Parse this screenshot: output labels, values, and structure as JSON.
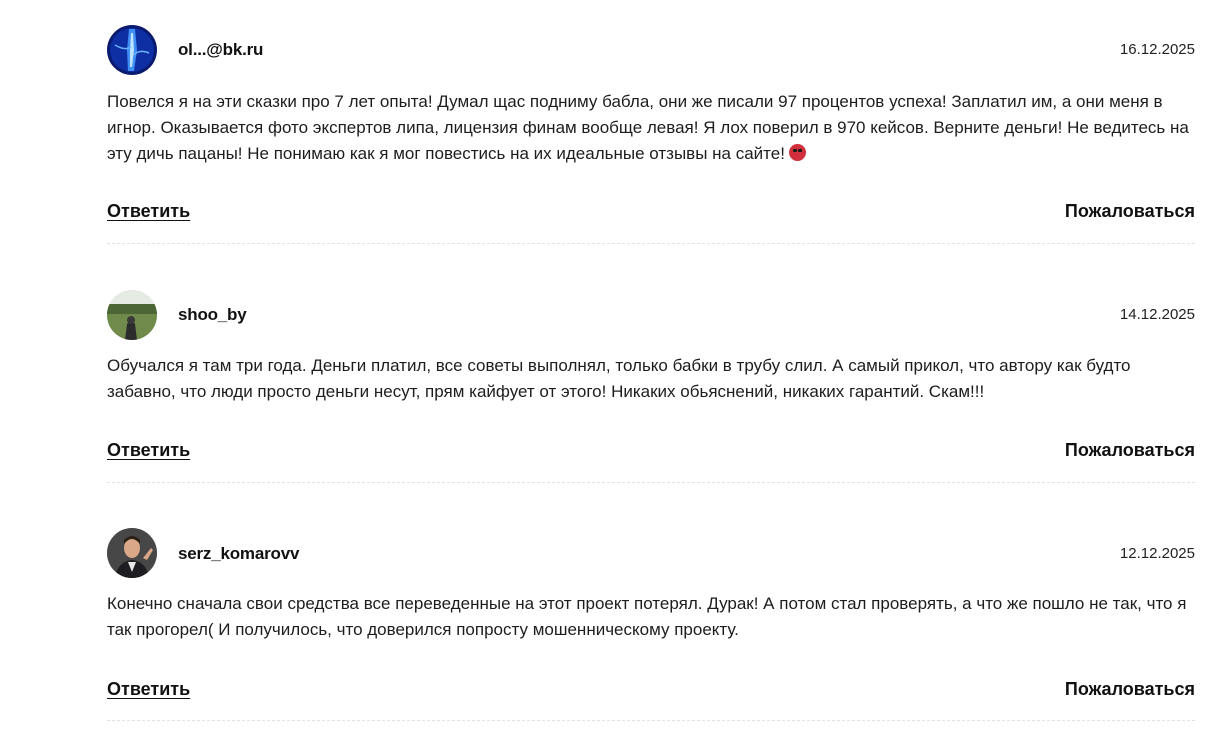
{
  "comments": [
    {
      "username": "ol...@bk.ru",
      "date": "16.12.2025",
      "text": "Повелся я на эти сказки про 7 лет опыта! Думал щас подниму бабла, они же писали 97 процентов успеха! Заплатил им, а они меня в игнор. Оказывается фото экспертов липа, лицензия финам вообще левая! Я лох поверил в 970 кейсов. Верните деньги! Не ведитесь на эту дичь пацаны! Не понимаю как я мог повестись на их идеальные отзывы на сайте!",
      "emoji": "angry-face-emoji",
      "reply_label": "Ответить",
      "report_label": "Пожаловаться"
    },
    {
      "username": "shoo_by",
      "date": "14.12.2025",
      "text": "Обучался я там три года. Деньги платил, все советы выполнял, только бабки в трубу слил. А самый прикол, что автору как будто забавно, что люди просто деньги несут, прям кайфует от этого! Никаких обьяснений, никаких гарантий. Скам!!!",
      "reply_label": "Ответить",
      "report_label": "Пожаловаться"
    },
    {
      "username": "serz_komarovv",
      "date": "12.12.2025",
      "text": "Конечно сначала свои средства все переведенные на этот проект потерял. Дурак! А потом стал проверять, а что же пошло не так, что я так прогорел( И получилось, что доверился попросту мошенническому проекту.",
      "reply_label": "Ответить",
      "report_label": "Пожаловаться"
    }
  ],
  "colors": {
    "text": "#1d1d1d",
    "divider": "#e2e2e2",
    "emoji": "#d22f3c"
  }
}
